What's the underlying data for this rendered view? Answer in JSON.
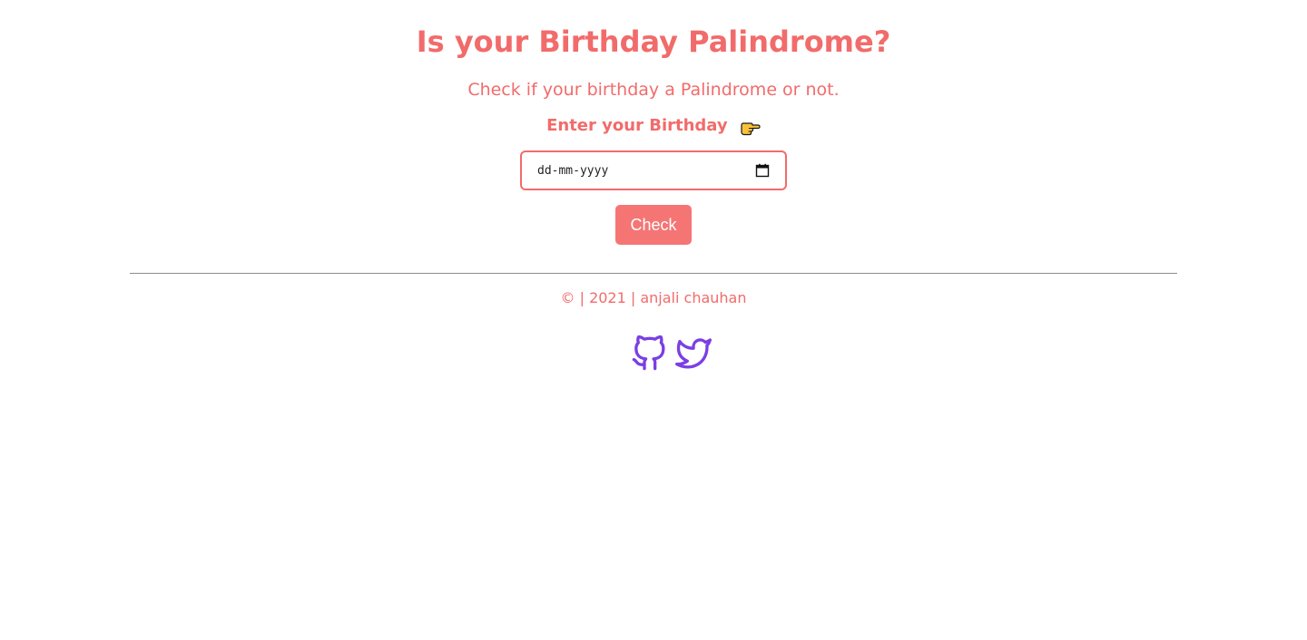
{
  "header": {
    "title": "Is your Birthday Palindrome?",
    "subtitle": "Check if your birthday a Palindrome or not."
  },
  "form": {
    "label": "Enter your Birthday",
    "label_icon": "pointing-hand-icon",
    "date_placeholder": "dd-mm-yyyy",
    "date_icon": "calendar-icon",
    "check_label": "Check"
  },
  "footer": {
    "text": "© | 2021 | anjali chauhan",
    "links": [
      {
        "icon": "github-icon"
      },
      {
        "icon": "twitter-icon"
      }
    ]
  },
  "colors": {
    "accent": "#f26b6b",
    "button": "#f57575",
    "social": "#7a3fe4",
    "divider": "#8c8c8c"
  }
}
